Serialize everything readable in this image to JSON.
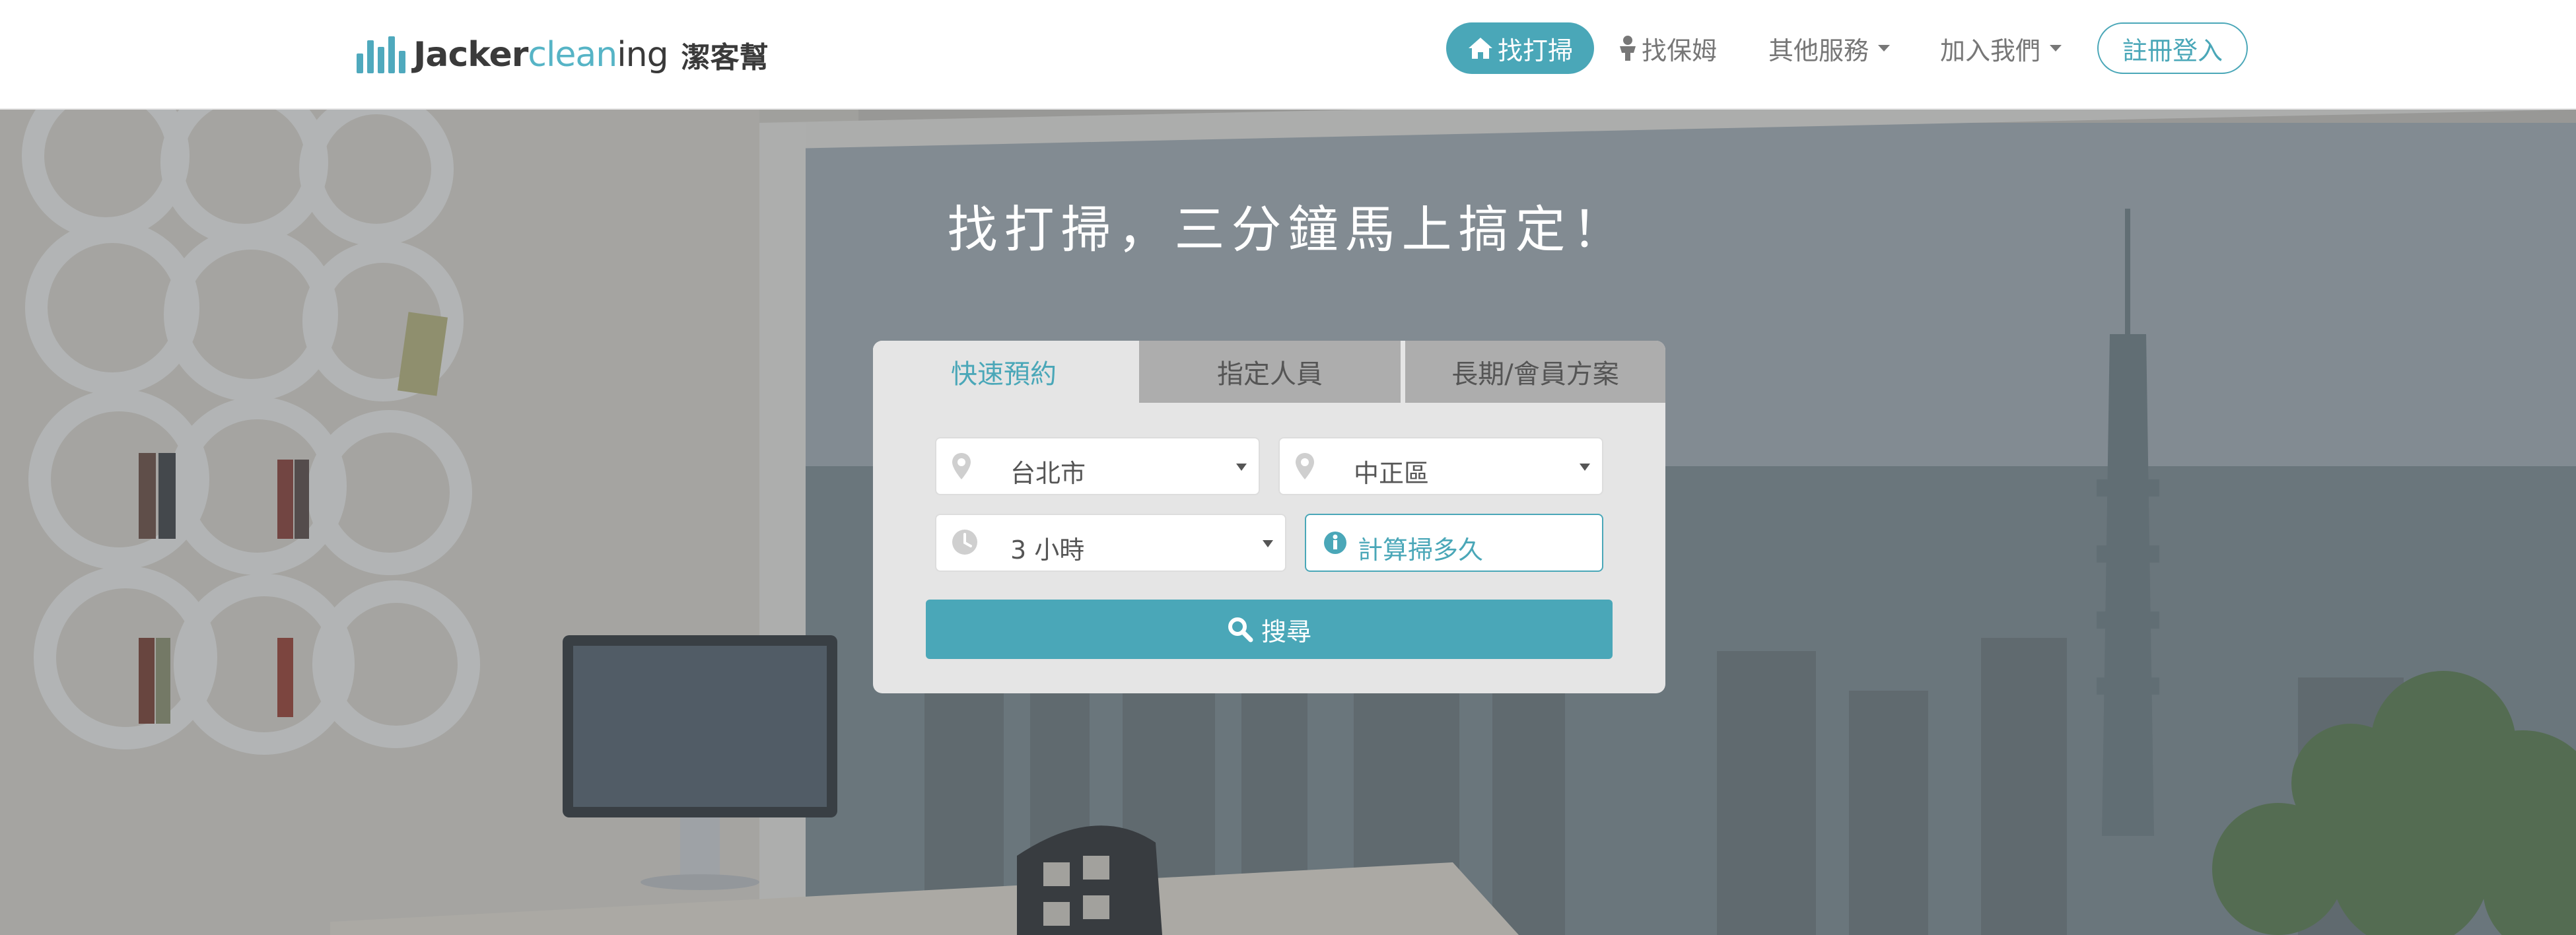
{
  "brand": {
    "name_part1": "Jacker",
    "name_part2": "clean",
    "name_part3": "ing",
    "chinese_name": "潔客幫",
    "accent_color": "#4aa7b8"
  },
  "nav": {
    "find_cleaning": "找打掃",
    "find_nanny": "找保姆",
    "other_services": "其他服務",
    "join_us": "加入我們",
    "register_login": "註冊登入"
  },
  "hero": {
    "title": "找打掃，三分鐘馬上搞定！"
  },
  "search": {
    "tabs": [
      {
        "label": "快速預約",
        "active": true
      },
      {
        "label": "指定人員",
        "active": false
      },
      {
        "label": "長期/會員方案",
        "active": false
      }
    ],
    "city": "台北市",
    "district": "中正區",
    "hours": "3 小時",
    "calc_label": "計算掃多久",
    "search_button": "搜尋"
  },
  "icons": {
    "home": "home-icon",
    "nanny": "person-icon",
    "location": "map-marker-icon",
    "clock": "clock-icon",
    "info": "info-circle-icon",
    "search": "search-icon"
  }
}
